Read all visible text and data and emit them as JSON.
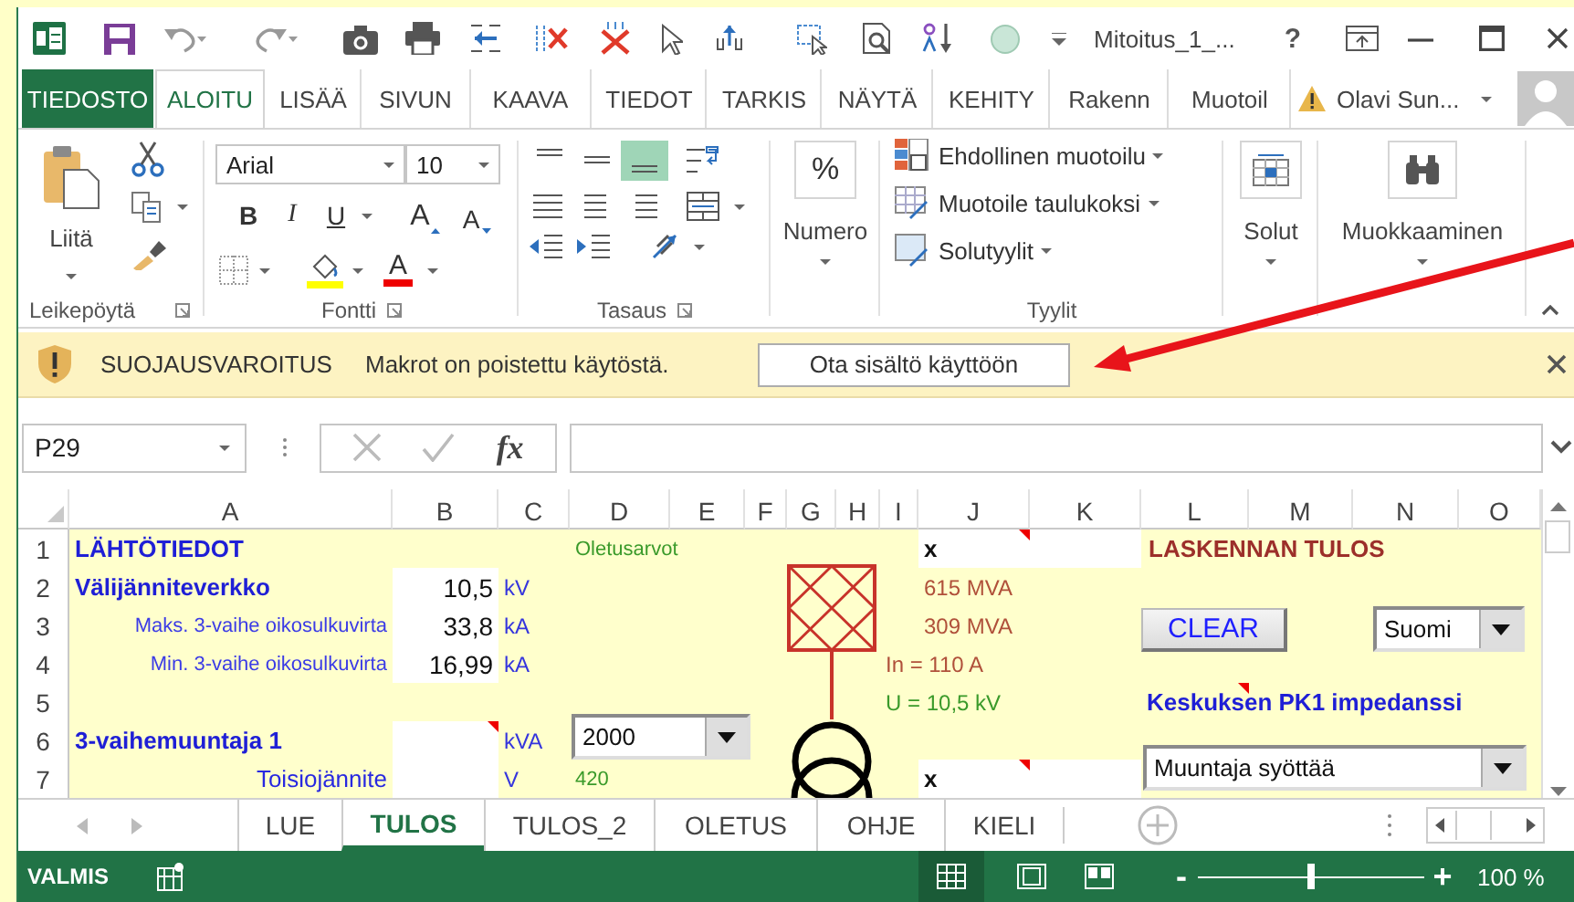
{
  "title_bar": {
    "document_title": "Mitoitus_1_...",
    "help": "?"
  },
  "ribbon_tabs": [
    {
      "label": "TIEDOSTO",
      "kind": "file",
      "selected": false
    },
    {
      "label": "ALOITU",
      "kind": "tab",
      "selected": true
    },
    {
      "label": "LISÄÄ",
      "kind": "tab",
      "selected": false
    },
    {
      "label": "SIVUN",
      "kind": "tab",
      "selected": false
    },
    {
      "label": "KAAVA",
      "kind": "tab",
      "selected": false
    },
    {
      "label": "TIEDOT",
      "kind": "tab",
      "selected": false
    },
    {
      "label": "TARKIS",
      "kind": "tab",
      "selected": false
    },
    {
      "label": "NÄYTÄ",
      "kind": "tab",
      "selected": false
    },
    {
      "label": "KEHITY",
      "kind": "tab",
      "selected": false
    },
    {
      "label": "Rakenn",
      "kind": "tab",
      "selected": false
    },
    {
      "label": "Muotoil",
      "kind": "tab",
      "selected": false
    }
  ],
  "account": {
    "name": "Olavi Sun..."
  },
  "ribbon": {
    "clipboard": {
      "paste": "Liitä",
      "label": "Leikepöytä"
    },
    "font": {
      "font_name": "Arial",
      "font_size": "10",
      "styles": [
        "B",
        "I",
        "U"
      ],
      "grow": "A",
      "shrink": "A",
      "font_color": "A",
      "label": "Fontti"
    },
    "alignment": {
      "vertical": [
        {
          "selected": false
        },
        {
          "selected": false
        },
        {
          "selected": true
        }
      ],
      "label": "Tasaus"
    },
    "number": {
      "symbol": "%",
      "label": "Numero"
    },
    "styles": {
      "items": [
        "Ehdollinen muotoilu",
        "Muotoile taulukoksi",
        "Solutyylit"
      ],
      "label": "Tyylit"
    },
    "cells": {
      "label": "Solut"
    },
    "editing": {
      "label": "Muokkaaminen"
    }
  },
  "message_bar": {
    "title": "SUOJAUSVAROITUS",
    "message": "Makrot on poistettu käytöstä.",
    "button": "Ota sisältö käyttöön"
  },
  "formula_bar": {
    "name_box": "P29",
    "function_label": "fx"
  },
  "sheet": {
    "columns": [
      "A",
      "B",
      "C",
      "D",
      "E",
      "F",
      "G",
      "H",
      "I",
      "J",
      "K",
      "L",
      "M",
      "N",
      "O"
    ],
    "rows": [
      {
        "header": "1",
        "cells": [
          {
            "kind": "heading",
            "text": "LÄHTÖTIEDOT",
            "comment": false
          },
          {
            "kind": "blank"
          },
          {
            "kind": "blank"
          },
          {
            "kind": "default",
            "text": "Oletusarvot",
            "comment": false
          },
          {
            "kind": "blank"
          },
          {
            "kind": "blank"
          },
          {
            "kind": "blank"
          },
          {
            "kind": "blank"
          },
          {
            "kind": "blank"
          },
          {
            "kind": "marker",
            "text": "x",
            "comment": true
          },
          {
            "kind": "input",
            "comment": false
          },
          {
            "kind": "result_title",
            "text": "LASKENNAN TULOS",
            "comment": false
          }
        ]
      },
      {
        "header": "2",
        "cells": [
          {
            "kind": "section",
            "text": "Välijänniteverkko",
            "comment": false
          },
          {
            "kind": "input",
            "text": "10,5",
            "comment": false
          },
          {
            "kind": "unit",
            "text": "kV",
            "comment": false
          },
          {
            "kind": "blank"
          },
          {
            "kind": "blank"
          },
          {
            "kind": "blank"
          },
          {
            "kind": "blank"
          },
          {
            "kind": "blank"
          },
          {
            "kind": "blank"
          },
          {
            "kind": "result",
            "text": "615 MVA",
            "comment": false
          }
        ]
      },
      {
        "header": "3",
        "cells": [
          {
            "kind": "sublabel",
            "text": "Maks. 3-vaihe oikosulkuvirta",
            "comment": false
          },
          {
            "kind": "input",
            "text": "33,8",
            "comment": false
          },
          {
            "kind": "unit",
            "text": "kA",
            "comment": false
          },
          {
            "kind": "blank"
          },
          {
            "kind": "blank"
          },
          {
            "kind": "blank"
          },
          {
            "kind": "blank"
          },
          {
            "kind": "blank"
          },
          {
            "kind": "blank"
          },
          {
            "kind": "result",
            "text": "309 MVA",
            "comment": false
          }
        ]
      },
      {
        "header": "4",
        "cells": [
          {
            "kind": "sublabel",
            "text": "Min. 3-vaihe oikosulkuvirta",
            "comment": false
          },
          {
            "kind": "input",
            "text": "16,99",
            "comment": false
          },
          {
            "kind": "unit",
            "text": "kA",
            "comment": false
          },
          {
            "kind": "blank"
          },
          {
            "kind": "blank"
          },
          {
            "kind": "blank"
          },
          {
            "kind": "blank"
          },
          {
            "kind": "blank"
          },
          {
            "kind": "result",
            "text": "In = 110 A",
            "comment": false
          }
        ]
      },
      {
        "header": "5",
        "cells": [
          {
            "kind": "blank"
          },
          {
            "kind": "blank"
          },
          {
            "kind": "blank"
          },
          {
            "kind": "blank"
          },
          {
            "kind": "blank"
          },
          {
            "kind": "blank"
          },
          {
            "kind": "blank"
          },
          {
            "kind": "blank"
          },
          {
            "kind": "result_ok",
            "text": "U = 10,5 kV",
            "comment": false
          },
          {
            "kind": "blank"
          },
          {
            "kind": "blank"
          },
          {
            "kind": "section",
            "text": "Keskuksen PK1 impedanssi",
            "comment": true
          }
        ]
      },
      {
        "header": "6",
        "cells": [
          {
            "kind": "section",
            "text": "3-vaihemuuntaja 1",
            "comment": false
          },
          {
            "kind": "input",
            "comment": true
          },
          {
            "kind": "unit",
            "text": "kVA",
            "comment": false
          }
        ]
      },
      {
        "header": "7",
        "cells": [
          {
            "kind": "caption",
            "text": "Toisiojännite",
            "comment": false
          },
          {
            "kind": "input",
            "comment": false
          },
          {
            "kind": "unit",
            "text": "V",
            "comment": false
          },
          {
            "kind": "default",
            "text": "420",
            "comment": false
          },
          {
            "kind": "blank"
          },
          {
            "kind": "blank"
          },
          {
            "kind": "blank"
          },
          {
            "kind": "blank"
          },
          {
            "kind": "blank"
          },
          {
            "kind": "marker",
            "text": "x",
            "comment": true
          },
          {
            "kind": "input",
            "comment": false
          }
        ]
      }
    ],
    "clear_button": "CLEAR",
    "dropdowns": [
      {
        "value": "Suomi"
      },
      {
        "value": "2000"
      },
      {
        "value": "Muuntaja syöttää"
      }
    ]
  },
  "sheet_tabs": [
    {
      "label": "LUE",
      "selected": false
    },
    {
      "label": "TULOS",
      "selected": true
    },
    {
      "label": "TULOS_2",
      "selected": false
    },
    {
      "label": "OLETUS",
      "selected": false
    },
    {
      "label": "OHJE",
      "selected": false
    },
    {
      "label": "KIELI",
      "selected": false
    }
  ],
  "status_bar": {
    "mode": "VALMIS",
    "views": [
      {
        "selected": true
      },
      {
        "selected": false
      },
      {
        "selected": false
      }
    ],
    "zoom_out": "-",
    "zoom_in": "+",
    "zoom_slider": {
      "level": 0.5
    },
    "zoom_label": "100 %"
  }
}
